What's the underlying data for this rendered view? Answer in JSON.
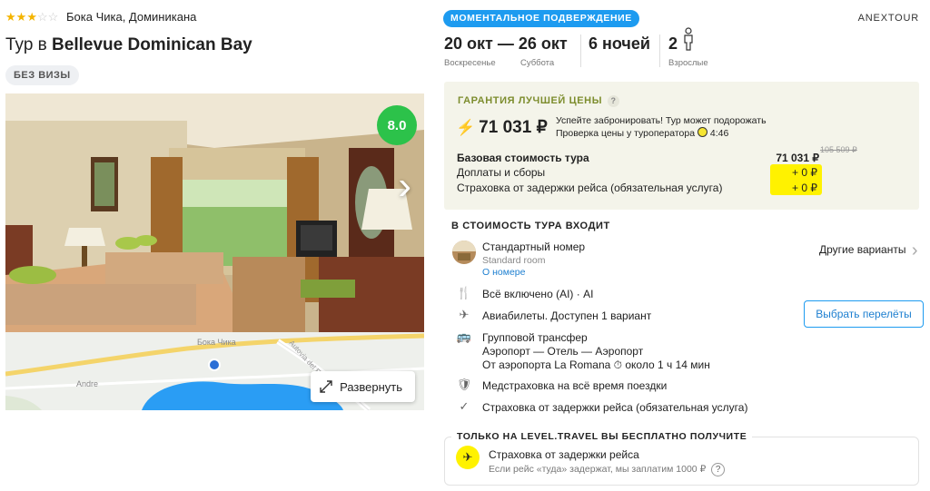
{
  "hotel": {
    "stars_filled": 3,
    "stars_total": 5,
    "location": "Бока Чика, Доминикана",
    "title_prefix": "Тур в",
    "title_name": "Bellevue Dominican Bay",
    "visa_badge": "БЕЗ ВИЗЫ",
    "rating": "8.0"
  },
  "map": {
    "place_top": "Бока Чика",
    "place_left": "Andre",
    "road": "Autovia del Este",
    "expand_label": "Развернуть"
  },
  "tour": {
    "instant_badge": "МОМЕНТАЛЬНОЕ ПОДВЕРЖДЕНИЕ",
    "operator": "ANEXTOUR",
    "date_from": "20 окт",
    "date_from_day": "Воскресенье",
    "date_dash": "—",
    "date_to": "26 окт",
    "date_to_day": "Суббота",
    "nights": "6 ночей",
    "adults_count": "2",
    "adults_label": "Взрослые"
  },
  "price": {
    "guarantee_title": "ГАРАНТИЯ ЛУЧШЕЙ ЦЕНЫ",
    "guarantee_q": "?",
    "total": "71 031 ₽",
    "hurry_line1": "Успейте забронировать! Тур может подорожать",
    "hurry_line2": "Проверка цены у туроператора",
    "timer": "4:46",
    "base_label": "Базовая стоимость тура",
    "base_value": "71 031 ₽",
    "old_value": "105 509 ₽",
    "fees_label": "Доплаты и сборы",
    "fees_value": "+ 0 ₽",
    "insurance_label": "Страховка от задержки рейса (обязательная услуга)",
    "insurance_value": "+ 0 ₽"
  },
  "included": {
    "heading": "В СТОИМОСТЬ ТУРА ВХОДИТ",
    "room_name": "Стандартный номер",
    "room_sub": "Standard room",
    "room_link": "О номере",
    "other_options": "Другие варианты",
    "meal": "Всё включено (AI) · AI",
    "flights": "Авиабилеты. Доступен 1 вариант",
    "choose_flights": "Выбрать перелёты",
    "transfer_title": "Групповой трансфер",
    "transfer_route": "Аэропорт — Отель — Аэропорт",
    "transfer_from": "От аэропорта La Romana",
    "transfer_time": "около 1 ч 14 мин",
    "med_insurance": "Медстраховка на всё время поездки",
    "delay_insurance": "Страховка от задержки рейса (обязательная услуга)"
  },
  "promo": {
    "heading": "ТОЛЬКО НА LEVEL.TRAVEL ВЫ БЕСПЛАТНО ПОЛУЧИТЕ",
    "title": "Страховка от задержки рейса",
    "desc": "Если рейс «туда» задержат, мы заплатим 1000 ₽",
    "q": "?"
  },
  "colors": {
    "accent_blue": "#1d9bf0",
    "rating_green": "#2cc24a",
    "highlight_yellow": "#fff200",
    "guarantee_olive": "#7d8d2e"
  }
}
